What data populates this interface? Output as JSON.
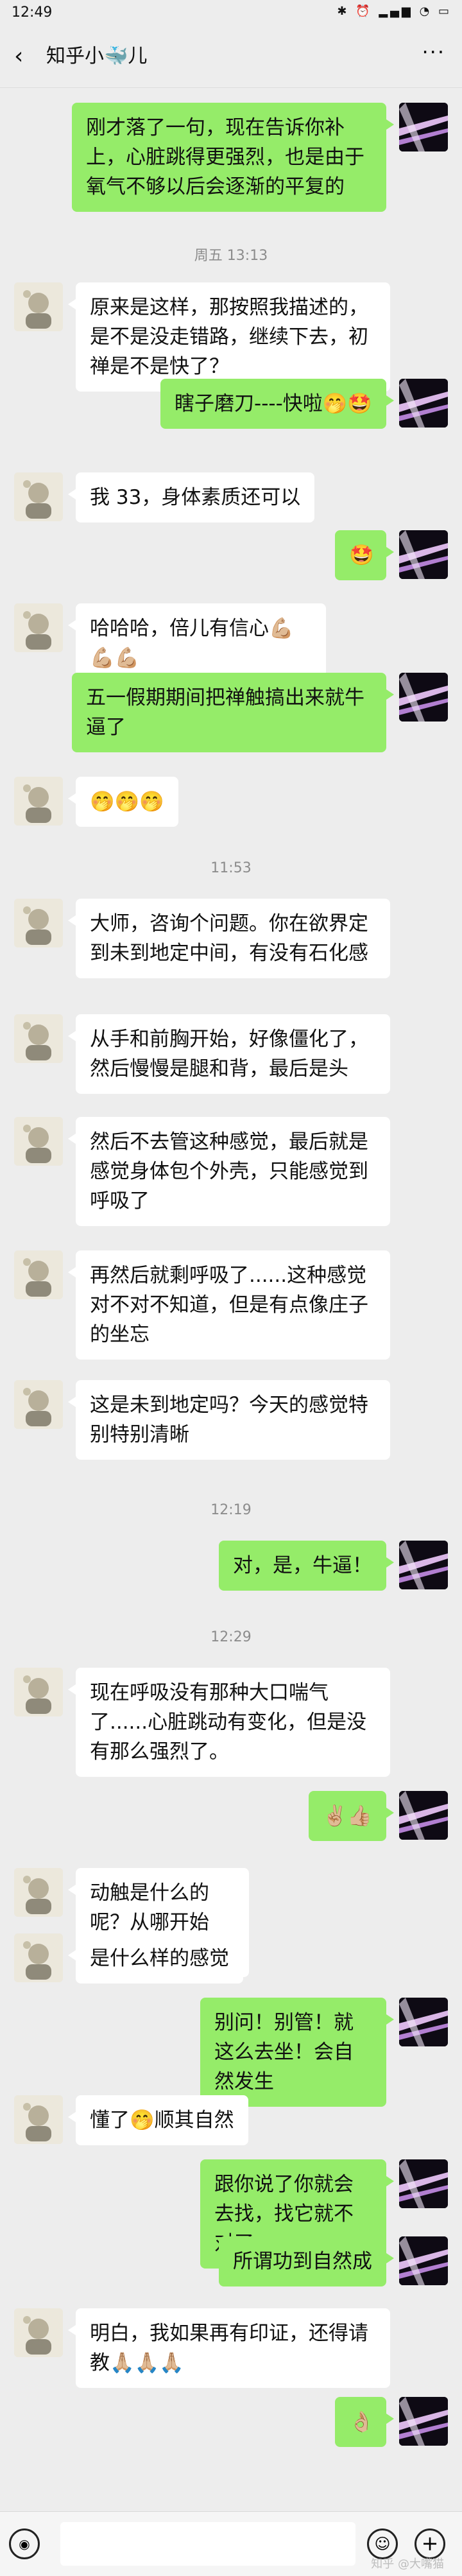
{
  "status": {
    "time": "12:49",
    "icons": "✱ ⏰ ▂▄▆ ◔ ▭"
  },
  "nav": {
    "title": "知乎小🐳儿",
    "back_icon": "chevron-left-icon",
    "more_icon": "more-dots-icon"
  },
  "messages": [
    {
      "side": "right",
      "text": "刚才落了一句，现在告诉你补上，心脏跳得更强烈，也是由于氧气不够以后会逐渐的平复的"
    },
    {
      "timestamp": "周五 13:13"
    },
    {
      "side": "left",
      "text": "原来是这样，那按照我描述的，是不是没走错路，继续下去，初禅是不是快了？"
    },
    {
      "side": "right",
      "text": "瞎子磨刀----快啦🤭🤩"
    },
    {
      "side": "left",
      "text": "我 33，身体素质还可以"
    },
    {
      "side": "right",
      "text": "🤩"
    },
    {
      "side": "left",
      "text": "哈哈哈，倍儿有信心💪🏼💪🏼💪🏼"
    },
    {
      "side": "right",
      "text": "五一假期期间把禅触搞出来就牛逼了"
    },
    {
      "side": "left",
      "text": "🤭🤭🤭"
    },
    {
      "timestamp": "11:53"
    },
    {
      "side": "left",
      "text": "大师，咨询个问题。你在欲界定到未到地定中间，有没有石化感"
    },
    {
      "side": "left",
      "text": "从手和前胸开始，好像僵化了，然后慢慢是腿和背，最后是头"
    },
    {
      "side": "left",
      "text": "然后不去管这种感觉，最后就是感觉身体包个外壳，只能感觉到呼吸了"
    },
    {
      "side": "left",
      "text": "再然后就剩呼吸了......这种感觉对不对不知道，但是有点像庄子的坐忘"
    },
    {
      "side": "left",
      "text": "这是未到地定吗？今天的感觉特别特别清晰"
    },
    {
      "timestamp": "12:19"
    },
    {
      "side": "right",
      "text": "对，是，牛逼！"
    },
    {
      "timestamp": "12:29"
    },
    {
      "side": "left",
      "text": "现在呼吸没有那种大口喘气了......心脏跳动有变化，但是没有那么强烈了。"
    },
    {
      "side": "right",
      "text": "✌🏼👍🏼"
    },
    {
      "side": "left",
      "text": "动触是什么的呢？从哪开始动？"
    },
    {
      "side": "left",
      "text": "是什么样的感觉"
    },
    {
      "side": "right",
      "text": "别问！别管！就这么去坐！会自然发生"
    },
    {
      "side": "left",
      "text": "懂了🤭顺其自然"
    },
    {
      "side": "right",
      "text": "跟你说了你就会去找，找它就不对了"
    },
    {
      "side": "right",
      "text": "所谓功到自然成"
    },
    {
      "side": "left",
      "text": "明白，我如果再有印证，还得请教🙏🏼🙏🏼🙏🏼"
    },
    {
      "side": "right",
      "text": "👌🏼"
    }
  ],
  "input": {
    "voice_icon": "voice-icon",
    "emoji_icon": "emoji-icon",
    "plus_icon": "plus-icon"
  },
  "watermark": "知乎 @大嘴猫"
}
